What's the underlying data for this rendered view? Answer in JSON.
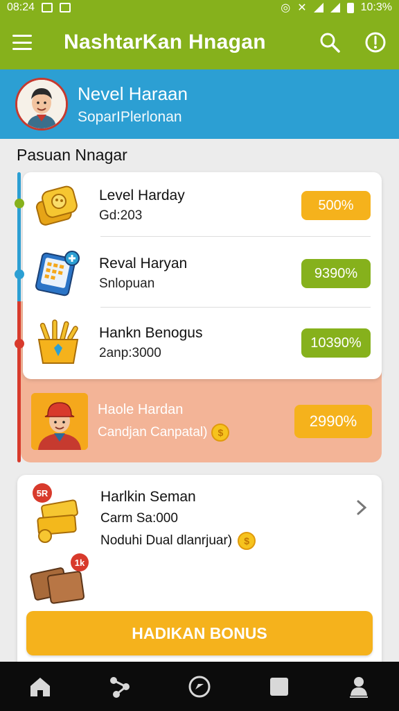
{
  "status_bar": {
    "time": "08:24",
    "right_time": "10:3%"
  },
  "app_bar": {
    "title": "NashtarKan Hnagan"
  },
  "profile": {
    "name": "Nevel Haraan",
    "subtitle": "SoparIPlerlonan"
  },
  "section": {
    "title": "Pasuan Nnagar"
  },
  "tasks": [
    {
      "title": "Level Harday",
      "sub": "Gd:203",
      "value": "500%",
      "color": "#f5b21c",
      "icon": "coin-stack-icon"
    },
    {
      "title": "Reval Haryan",
      "sub": "Snlopuan",
      "value": "9390%",
      "color": "#86b11c",
      "icon": "calendar-tablet-icon"
    },
    {
      "title": "Hankn Benogus",
      "sub": "2anp:3000",
      "value": "10390%",
      "color": "#86b11c",
      "icon": "basket-icon"
    }
  ],
  "highlight": {
    "title": "Haole Hardan",
    "sub": "Candjan Canpatal)",
    "value": "2990%",
    "coin_symbol": "$"
  },
  "bonus": {
    "title": "Harlkin Seman",
    "sub1": "Carm Sa:000",
    "sub2": "Noduhi Dual dlanrjuar)",
    "coin_symbol": "$",
    "badge_top": "5R",
    "badge_bot": "1k",
    "cta": "HADIKAN BONUS"
  },
  "colors": {
    "primary_green": "#86b11c",
    "blue": "#2c9fd3",
    "orange": "#f5b21c",
    "red": "#d83a2c",
    "peach": "#f3b497"
  }
}
